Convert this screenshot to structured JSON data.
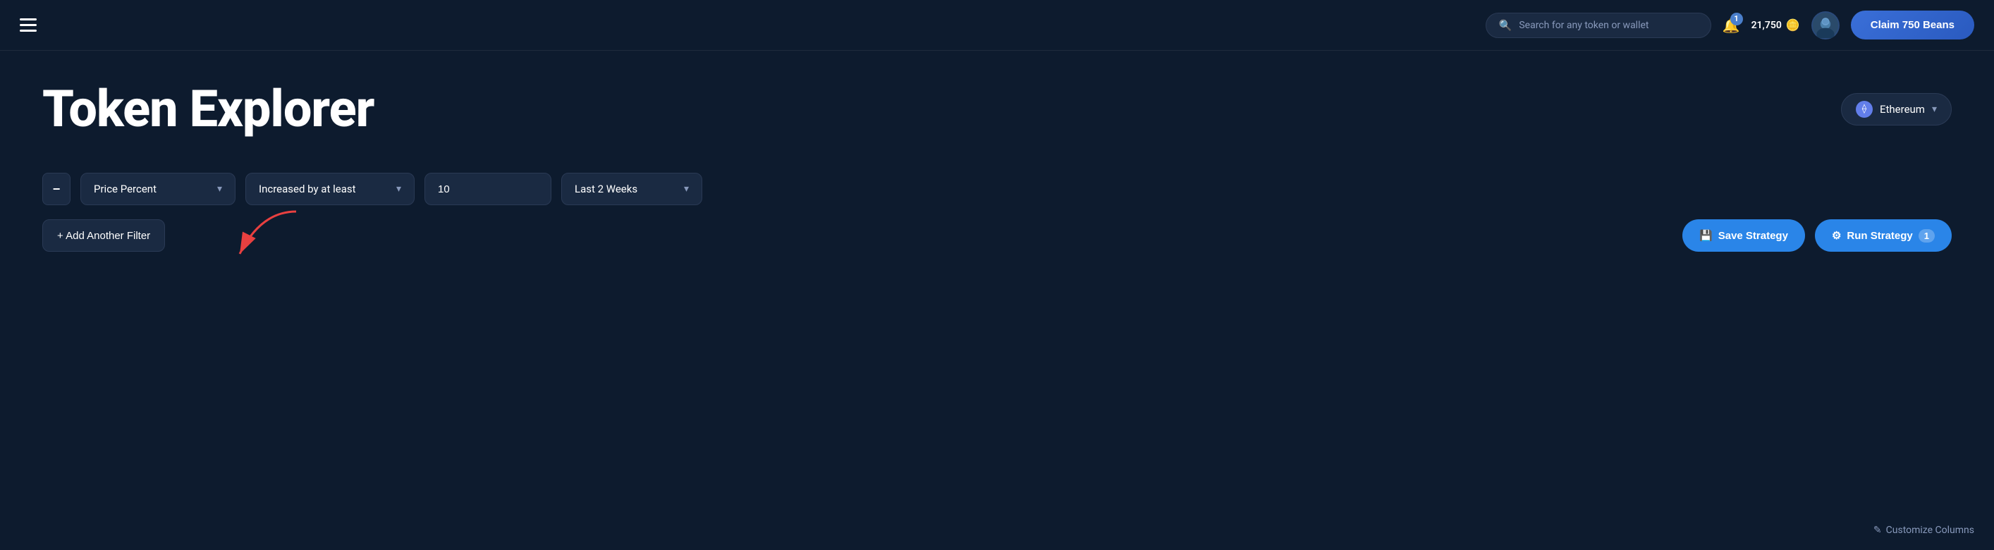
{
  "navbar": {
    "search_placeholder": "Search for any token or wallet",
    "notification_count": "1",
    "beans_count": "21,750",
    "claim_button_label": "Claim 750 Beans"
  },
  "page": {
    "title": "Token Explorer",
    "network_label": "Ethereum"
  },
  "filter": {
    "remove_label": "−",
    "price_percent_label": "Price Percent",
    "increased_by_label": "Increased by at least",
    "value": "10",
    "time_label": "Last 2 Weeks",
    "add_filter_label": "+ Add Another Filter",
    "save_strategy_label": "Save Strategy",
    "run_strategy_label": "Run Strategy",
    "run_badge": "1"
  },
  "footer": {
    "customize_columns_label": "Customize Columns"
  },
  "icons": {
    "search": "🔍",
    "hamburger": "☰",
    "chevron_down": "▾",
    "ethereum": "⟠",
    "save": "💾",
    "filter": "⚙",
    "edit": "✎"
  }
}
